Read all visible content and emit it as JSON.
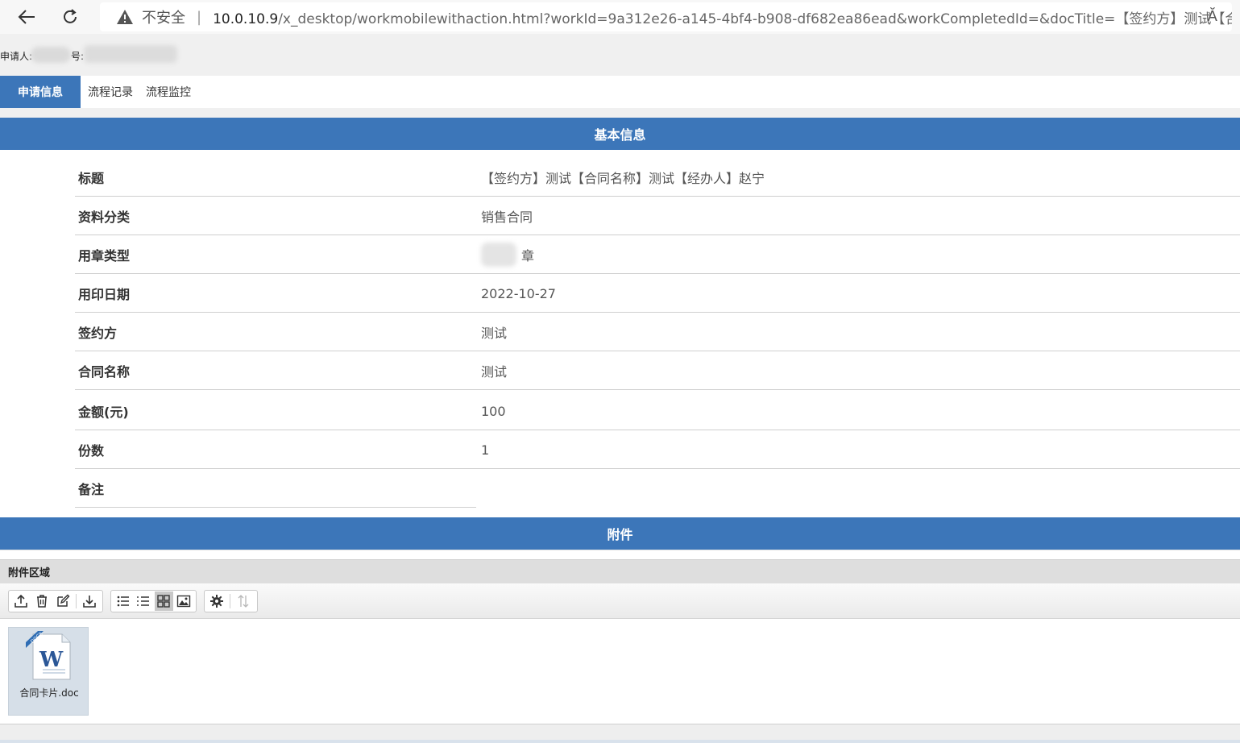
{
  "browser": {
    "insecure_label": "不安全",
    "separator": "|",
    "url_host": "10.0.10.9",
    "url_path": "/x_desktop/workmobilewithaction.html?workId=9a312e26-a145-4bf4-b908-df682ea86ead&workCompletedId=&docTitle=【签约方】测试【合同名...",
    "reader_label": "Ă"
  },
  "applicant": {
    "label": "申请人:",
    "sep": "号:"
  },
  "tabs": [
    {
      "label": "申请信息",
      "active": true
    },
    {
      "label": "流程记录",
      "active": false
    },
    {
      "label": "流程监控",
      "active": false
    }
  ],
  "sections": {
    "basic": "基本信息",
    "attachments": "附件"
  },
  "form": [
    {
      "label": "标题",
      "value": "【签约方】测试【合同名称】测试【经办人】赵宁"
    },
    {
      "label": "资料分类",
      "value": "销售合同"
    },
    {
      "label": "用章类型",
      "value": "章"
    },
    {
      "label": "用印日期",
      "value": "2022-10-27"
    },
    {
      "label": "签约方",
      "value": "测试"
    },
    {
      "label": "合同名称",
      "value": "测试"
    },
    {
      "label": "金额(元)",
      "value": "100"
    },
    {
      "label": "份数",
      "value": "1"
    },
    {
      "label": "备注",
      "value": ""
    }
  ],
  "attachment_area": {
    "title": "附件区域",
    "files": [
      {
        "name": "合同卡片.doc",
        "type_badge": "DOCX",
        "icon_letter": "W"
      }
    ]
  },
  "colors": {
    "accent": "#3c76b9"
  }
}
